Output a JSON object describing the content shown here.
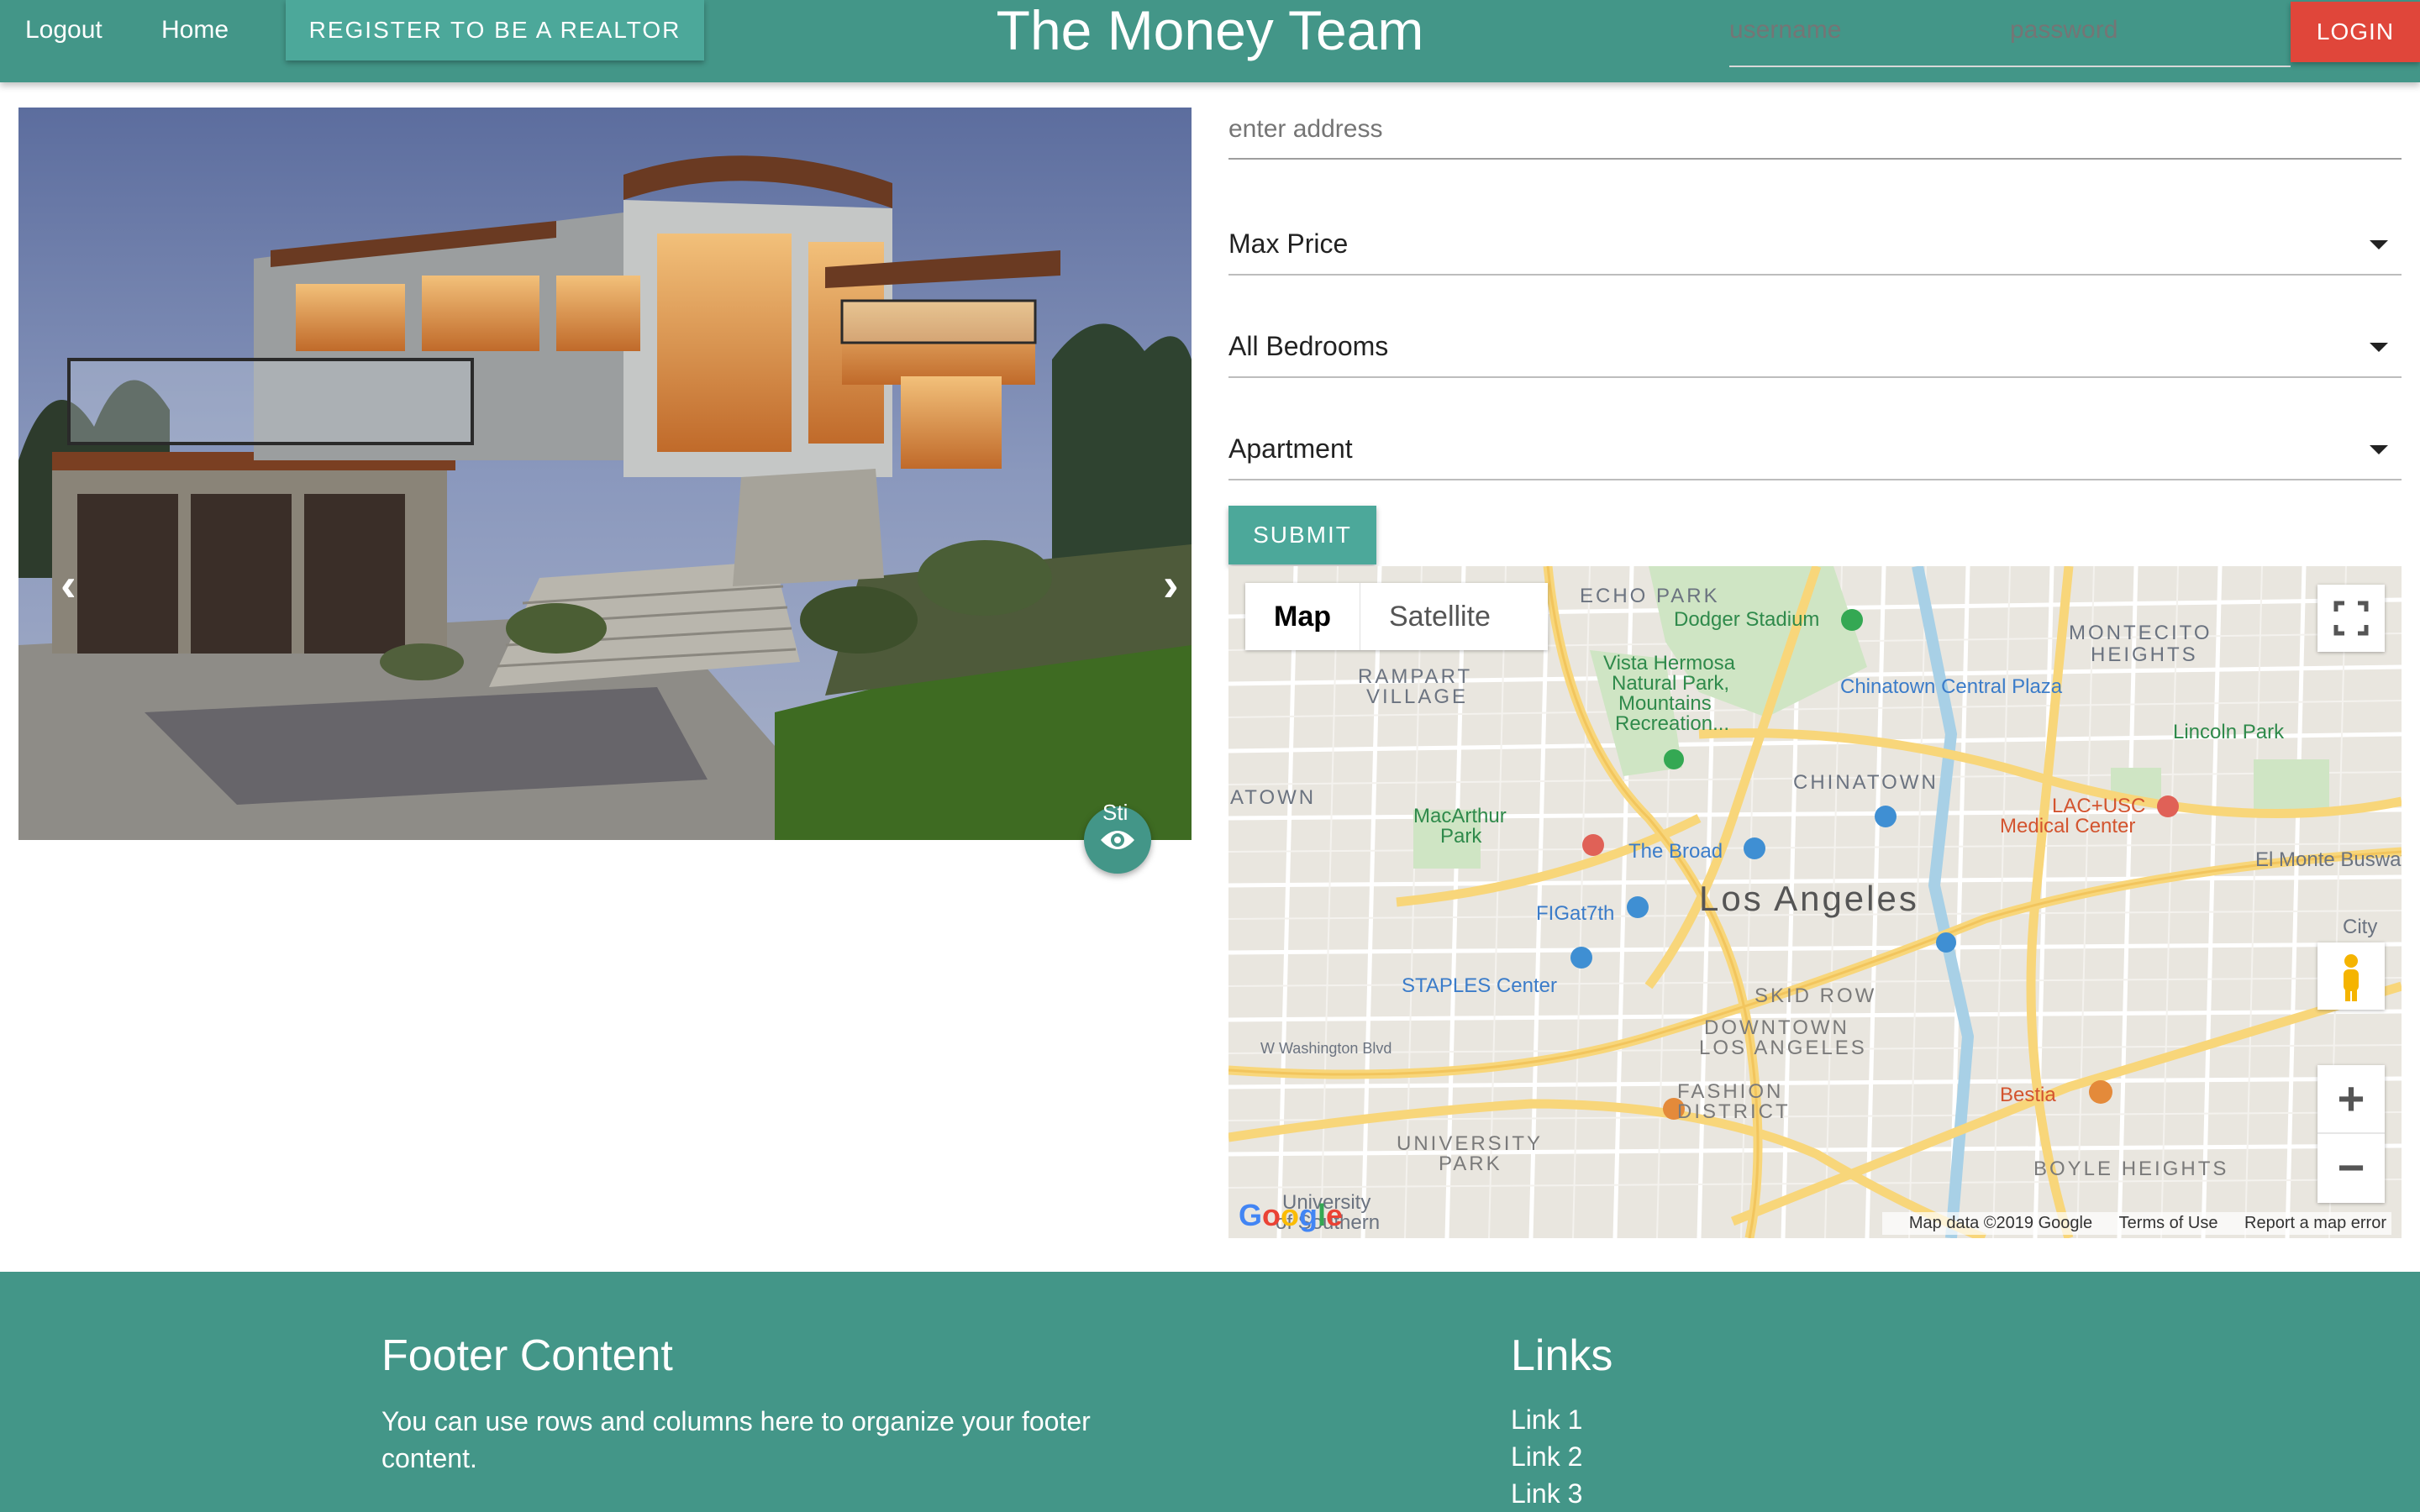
{
  "navbar": {
    "logout": "Logout",
    "home": "Home",
    "register": "REGISTER TO BE A REALTOR",
    "brand": "The Money Team",
    "username_placeholder": "username",
    "password_placeholder": "password",
    "login": "LOGIN",
    "color": "#439688",
    "login_color": "#e0463a"
  },
  "carousel": {
    "prev_icon": "chevron-left",
    "next_icon": "chevron-right",
    "fab_label": "Sti",
    "fab_icon": "eye-icon"
  },
  "search": {
    "address_placeholder": "enter address",
    "max_price": "Max Price",
    "bedrooms": "All Bedrooms",
    "property_type": "Apartment",
    "submit": "SUBMIT"
  },
  "map": {
    "type_map": "Map",
    "type_satellite": "Satellite",
    "labels": {
      "echo_park": "ECHO PARK",
      "dodger": "Dodger Stadium",
      "montecito": "MONTECITO",
      "heights": "HEIGHTS",
      "rampart": "RAMPART",
      "village": "VILLAGE",
      "vista1": "Vista Hermosa",
      "vista2": "Natural Park,",
      "vista3": "Mountains",
      "vista4": "Recreation...",
      "chinatown_plaza": "Chinatown Central Plaza",
      "lincoln": "Lincoln Park",
      "chinatown": "CHINATOWN",
      "atown": "ATOWN",
      "macarthur1": "MacArthur",
      "macarthur2": "Park",
      "lac1": "LAC+USC",
      "lac2": "Medical Center",
      "broad": "The Broad",
      "el_monte": "El Monte Busway",
      "los_angeles": "Los Angeles",
      "figat7th": "FIGat7th",
      "city": "City",
      "staples": "STAPLES Center",
      "skid_row": "SKID ROW",
      "downtown1": "DOWNTOWN",
      "downtown2": "LOS ANGELES",
      "washington": "W Washington Blvd",
      "fashion1": "FASHION",
      "fashion2": "DISTRICT",
      "bestia": "Bestia",
      "university1": "UNIVERSITY",
      "university2": "PARK",
      "boyle": "BOYLE HEIGHTS",
      "usc1": "University",
      "usc2": "of Southern"
    },
    "attribution": "Map data ©2019 Google",
    "terms": "Terms of Use",
    "report": "Report a map error",
    "google": "Google"
  },
  "footer": {
    "title": "Footer Content",
    "text": "You can use rows and columns here to organize your footer content.",
    "links_title": "Links",
    "links": [
      "Link 1",
      "Link 2",
      "Link 3"
    ]
  }
}
